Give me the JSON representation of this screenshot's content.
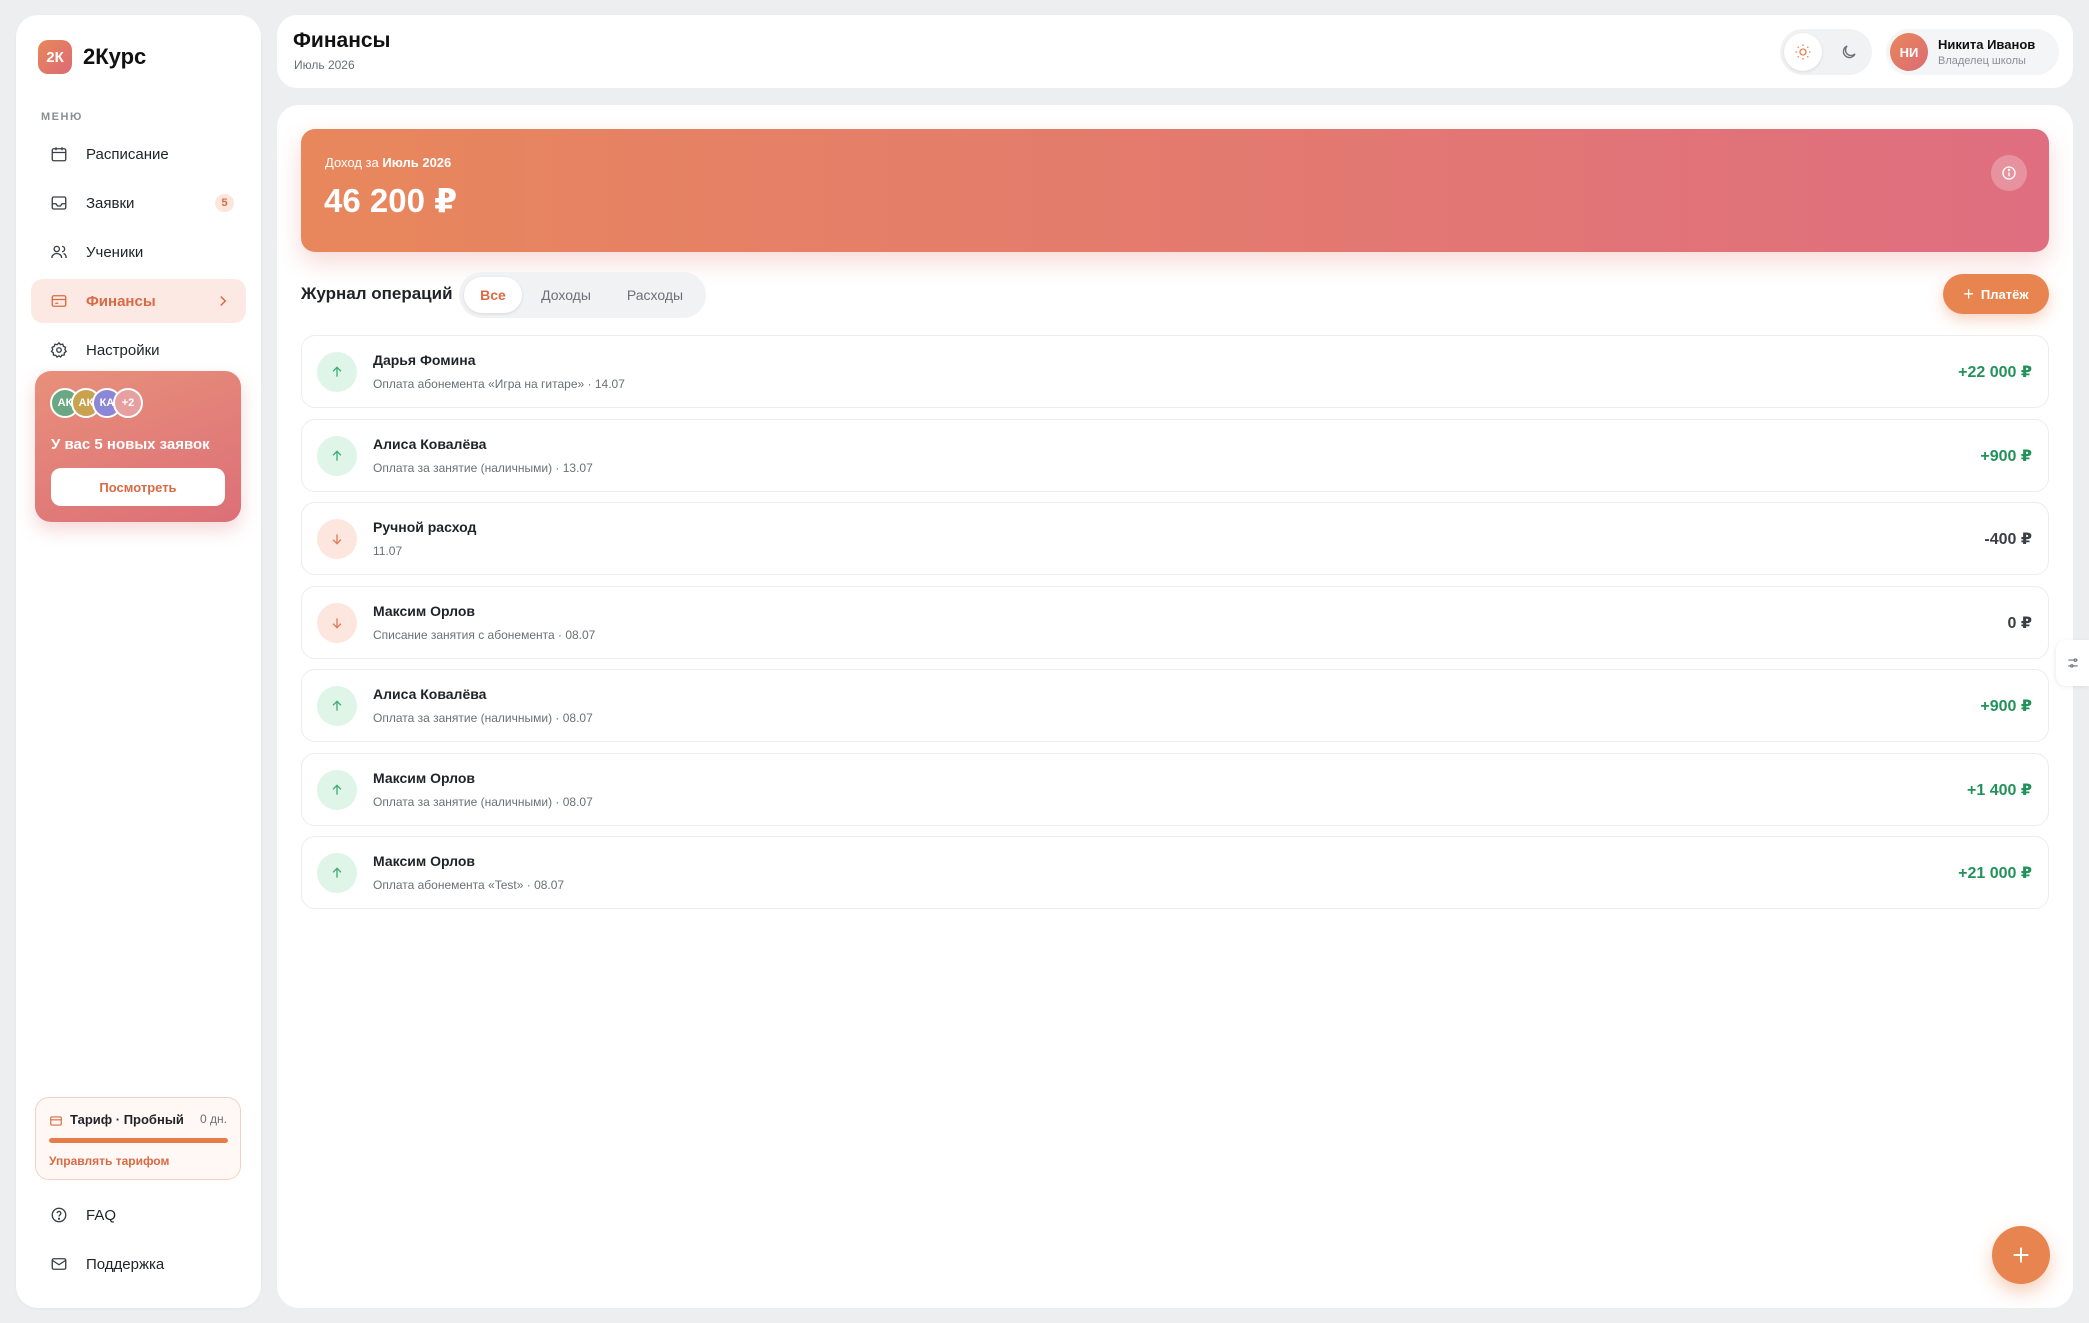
{
  "brand": {
    "badge": "2К",
    "name": "2Курс"
  },
  "sidebar": {
    "menu_caption": "МЕНЮ",
    "items": [
      {
        "label": "Расписание",
        "icon": "calendar-icon"
      },
      {
        "label": "Заявки",
        "icon": "inbox-icon",
        "badge": "5"
      },
      {
        "label": "Ученики",
        "icon": "users-icon"
      },
      {
        "label": "Финансы",
        "icon": "card-icon",
        "active": true
      },
      {
        "label": "Настройки",
        "icon": "gear-icon"
      }
    ],
    "promo": {
      "avatars": [
        "АК",
        "АК",
        "КА",
        "+2"
      ],
      "text": "У вас 5 новых заявок",
      "button": "Посмотреть"
    },
    "plan": {
      "title": "Тариф · Пробный",
      "days": "0 дн.",
      "progress": 1.0,
      "link": "Управлять тарифом"
    },
    "bottom": [
      {
        "label": "FAQ",
        "icon": "help-icon"
      },
      {
        "label": "Поддержка",
        "icon": "mail-icon"
      }
    ]
  },
  "header": {
    "title": "Финансы",
    "subtitle": "Июль 2026",
    "user": {
      "initials": "НИ",
      "name": "Никита Иванов",
      "role": "Владелец школы"
    }
  },
  "hero": {
    "label_prefix": "Доход за",
    "label_period": "Июль 2026",
    "amount": "46 200 ₽"
  },
  "journal": {
    "title": "Журнал операций",
    "tabs": [
      "Все",
      "Доходы",
      "Расходы"
    ],
    "active_tab": 0,
    "add_button": "Платёж",
    "operations": [
      {
        "name": "Дарья Фомина",
        "desc": "Оплата абонемента «Игра на гитаре» · 14.07",
        "amount": "+22 000 ₽",
        "type": "in"
      },
      {
        "name": "Алиса Ковалёва",
        "desc": "Оплата за занятие (наличными) · 13.07",
        "amount": "+900 ₽",
        "type": "in"
      },
      {
        "name": "Ручной расход",
        "desc": "11.07",
        "amount": "-400 ₽",
        "type": "out"
      },
      {
        "name": "Максим Орлов",
        "desc": "Списание занятия с абонемента · 08.07",
        "amount": "0 ₽",
        "type": "out"
      },
      {
        "name": "Алиса Ковалёва",
        "desc": "Оплата за занятие (наличными) · 08.07",
        "amount": "+900 ₽",
        "type": "in"
      },
      {
        "name": "Максим Орлов",
        "desc": "Оплата за занятие (наличными) · 08.07",
        "amount": "+1 400 ₽",
        "type": "in"
      },
      {
        "name": "Максим Орлов",
        "desc": "Оплата абонемента «Test» · 08.07",
        "amount": "+21 000 ₽",
        "type": "in"
      }
    ]
  },
  "colors": {
    "accent": "#e8844f",
    "income": "#23925a",
    "active_bg": "#fde9e3"
  }
}
